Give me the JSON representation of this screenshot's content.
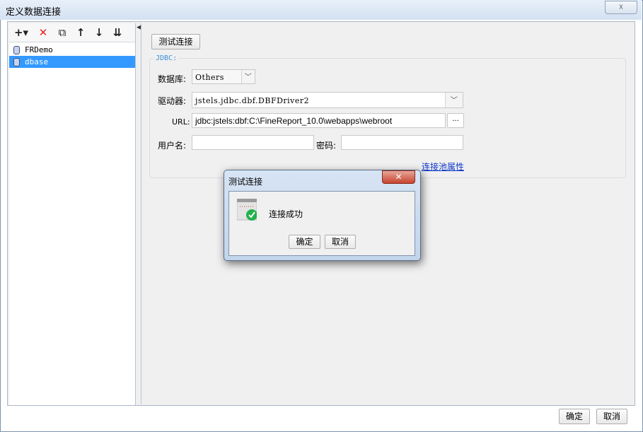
{
  "window": {
    "title": "定义数据连接",
    "close_glyph": "☓"
  },
  "toolbar": {
    "add_glyph": "+▾",
    "delete_glyph": "✕",
    "copy_glyph": "⧉",
    "up_glyph": "↑",
    "down_glyph": "↓",
    "sort_glyph": "⇊"
  },
  "connections": [
    {
      "label": "FRDemo",
      "selected": false
    },
    {
      "label": "dbase",
      "selected": true
    }
  ],
  "form": {
    "test_button": "测试连接",
    "group_title": "JDBC:",
    "database_label": "数据库:",
    "database_value": "Others",
    "driver_label": "驱动器:",
    "driver_value": "jstels.jdbc.dbf.DBFDriver2",
    "url_label": "URL:",
    "url_value": "jdbc:jstels:dbf:C:\\FineReport_10.0\\webapps\\webroot",
    "url_browse": "...",
    "username_label": "用户名:",
    "username_value": "",
    "password_label": "密码:",
    "password_value": "",
    "pool_link": "连接池属性"
  },
  "footer": {
    "ok": "确定",
    "cancel": "取消"
  },
  "dialog": {
    "title": "测试连接",
    "close_glyph": "✕",
    "message": "连接成功",
    "ok": "确定",
    "cancel": "取消"
  },
  "colors": {
    "selection": "#3399ff",
    "link": "#0a36c8",
    "group_title": "#3d8fd6",
    "success": "#22b14c"
  }
}
